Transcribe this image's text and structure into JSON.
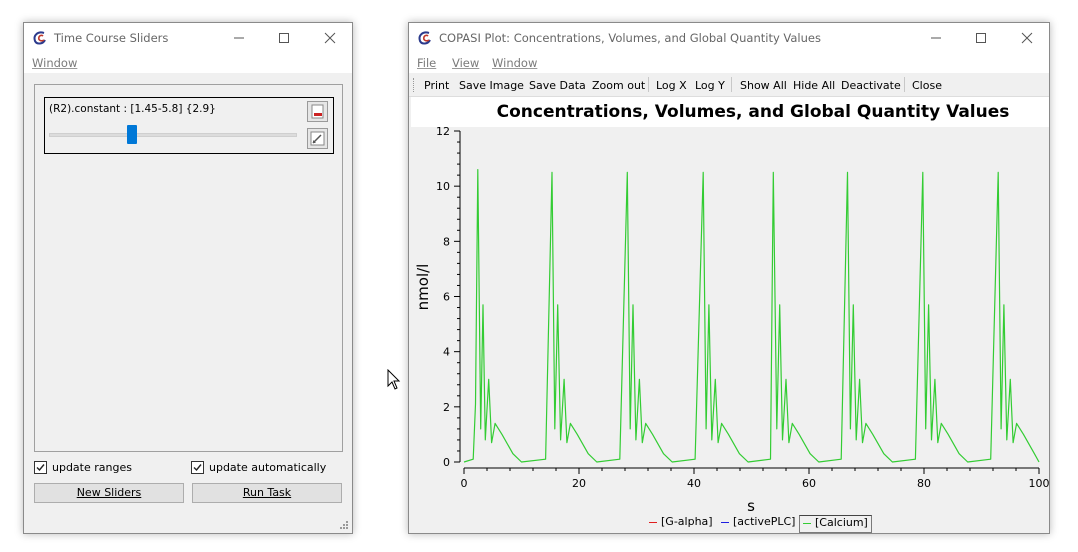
{
  "sliders_window": {
    "title": "Time Course Sliders",
    "menu": [
      "Window"
    ],
    "slider": {
      "label": "(R2).constant : [1.45-5.8] {2.9}",
      "min": 1.45,
      "max": 5.8,
      "value": 2.9
    },
    "update_ranges": {
      "label": "update ranges",
      "checked": true
    },
    "update_automatically": {
      "label": "update automatically",
      "checked": true
    },
    "new_sliders_label": "New Sliders",
    "run_task_label": "Run Task",
    "check_glyph": "✓"
  },
  "plot_window": {
    "title": "COPASI Plot: Concentrations, Volumes, and Global Quantity Values",
    "menu": [
      "File",
      "View",
      "Window"
    ],
    "toolbar": [
      "Print",
      "Save Image",
      "Save Data",
      "Zoom out",
      "Log X",
      "Log Y",
      "Show All",
      "Hide All",
      "Deactivate",
      "Close"
    ],
    "legend": [
      {
        "label": "[G-alpha]",
        "color": "#e01e1e",
        "selected": false
      },
      {
        "label": "[activePLC]",
        "color": "#1e1ee0",
        "selected": false
      },
      {
        "label": "[Calcium]",
        "color": "#33cc33",
        "selected": true
      }
    ]
  },
  "chart_data": {
    "type": "line",
    "title": "Concentrations, Volumes, and Global Quantity Values",
    "xlabel": "s",
    "ylabel": "nmol/l",
    "xlim": [
      0,
      100
    ],
    "ylim": [
      0,
      12
    ],
    "xticks": [
      0,
      20,
      40,
      60,
      80,
      100
    ],
    "yticks": [
      0,
      2,
      4,
      6,
      8,
      10,
      12
    ],
    "grid": false,
    "legend_position": "bottom",
    "series": [
      {
        "name": "[G-alpha]",
        "color": "#e01e1e",
        "x": [],
        "y": []
      },
      {
        "name": "[activePLC]",
        "color": "#1e1ee0",
        "x": [],
        "y": []
      },
      {
        "name": "[Calcium]",
        "color": "#33cc33",
        "x": [
          0,
          1.6,
          2.0,
          2.4,
          2.9,
          3.3,
          3.7,
          4.3,
          4.8,
          5.4,
          6.6,
          8.5,
          10.0,
          14.2,
          15.3,
          15.8,
          16.3,
          16.8,
          17.4,
          17.9,
          18.5,
          19.7,
          21.6,
          23.1,
          27.1,
          28.4,
          28.9,
          29.4,
          29.9,
          30.5,
          31.0,
          31.6,
          32.8,
          34.7,
          36.2,
          40.2,
          41.6,
          42.1,
          42.6,
          43.1,
          43.7,
          44.2,
          44.8,
          46.0,
          47.9,
          49.4,
          53.3,
          53.8,
          54.4,
          54.9,
          55.4,
          56.0,
          56.5,
          57.1,
          58.3,
          60.2,
          61.7,
          65.6,
          66.7,
          67.2,
          67.7,
          68.2,
          68.8,
          69.3,
          69.9,
          71.1,
          73.0,
          74.5,
          78.5,
          79.8,
          80.3,
          80.8,
          81.3,
          81.9,
          82.4,
          83.0,
          84.2,
          86.1,
          87.6,
          91.6,
          92.9,
          93.4,
          93.9,
          94.4,
          95.0,
          95.5,
          96.1,
          97.3,
          99.2,
          100
        ],
        "y": [
          0.0,
          0.1,
          2.1,
          10.6,
          1.2,
          5.7,
          0.8,
          3.0,
          0.7,
          1.4,
          1.0,
          0.3,
          0.0,
          0.1,
          10.5,
          1.2,
          5.7,
          0.8,
          3.0,
          0.7,
          1.4,
          1.0,
          0.3,
          0.0,
          0.1,
          10.5,
          1.2,
          5.7,
          0.8,
          3.0,
          0.7,
          1.4,
          1.0,
          0.3,
          0.0,
          0.1,
          10.5,
          1.2,
          5.7,
          0.8,
          3.0,
          0.7,
          1.4,
          1.0,
          0.3,
          0.0,
          0.1,
          10.5,
          1.2,
          5.7,
          0.8,
          3.0,
          0.7,
          1.4,
          1.0,
          0.3,
          0.0,
          0.1,
          10.5,
          1.2,
          5.7,
          0.8,
          3.0,
          0.7,
          1.4,
          1.0,
          0.3,
          0.0,
          0.1,
          10.5,
          1.2,
          5.7,
          0.8,
          3.0,
          0.7,
          1.4,
          1.0,
          0.3,
          0.0,
          0.1,
          10.5,
          1.2,
          5.7,
          0.8,
          3.0,
          0.7,
          1.4,
          1.0,
          0.3,
          0.0
        ]
      }
    ]
  }
}
